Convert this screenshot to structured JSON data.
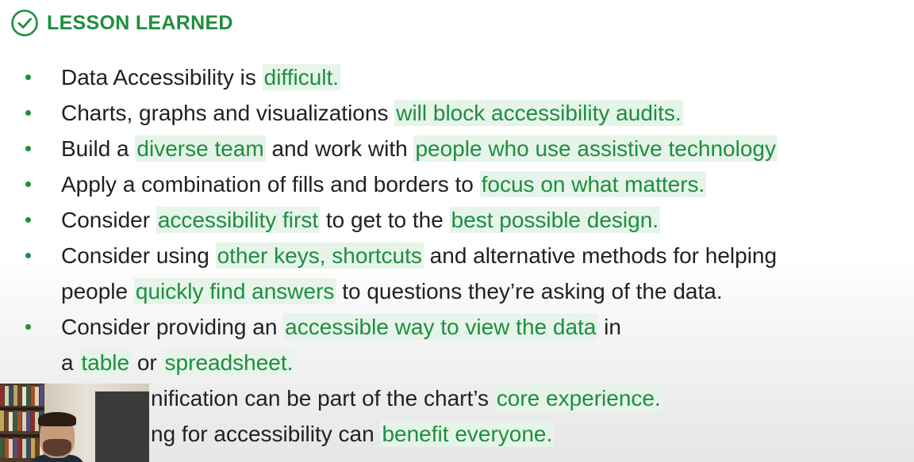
{
  "header": {
    "title": "LESSON LEARNED",
    "icon": "check-circle-icon",
    "color": "#1e8e3e"
  },
  "theme": {
    "accent": "#1e8e3e",
    "highlight_bg": "#e6f4ea",
    "text": "#202124"
  },
  "bullets": [
    {
      "lines": [
        [
          {
            "text": "Data Accessibility is ",
            "hl": false
          },
          {
            "text": "difficult.",
            "hl": true
          }
        ]
      ]
    },
    {
      "lines": [
        [
          {
            "text": "Charts, graphs and visualizations ",
            "hl": false
          },
          {
            "text": "will block accessibility audits.",
            "hl": true
          }
        ]
      ]
    },
    {
      "lines": [
        [
          {
            "text": "Build a ",
            "hl": false
          },
          {
            "text": "diverse team",
            "hl": true
          },
          {
            "text": " and work with ",
            "hl": false
          },
          {
            "text": "people who use assistive technology",
            "hl": true
          }
        ]
      ]
    },
    {
      "lines": [
        [
          {
            "text": "Apply a combination of fills and borders to ",
            "hl": false
          },
          {
            "text": "focus on what matters.",
            "hl": true
          }
        ]
      ]
    },
    {
      "lines": [
        [
          {
            "text": "Consider ",
            "hl": false
          },
          {
            "text": "accessibility first",
            "hl": true
          },
          {
            "text": " to get to the ",
            "hl": false
          },
          {
            "text": "best possible design.",
            "hl": true
          }
        ]
      ]
    },
    {
      "lines": [
        [
          {
            "text": "Consider using ",
            "hl": false
          },
          {
            "text": "other keys, shortcuts",
            "hl": true
          },
          {
            "text": " and alternative methods for helping",
            "hl": false
          }
        ],
        [
          {
            "text": "people ",
            "hl": false
          },
          {
            "text": "quickly find answers",
            "hl": true
          },
          {
            "text": " to questions they’re asking of the data.",
            "hl": false
          }
        ]
      ]
    },
    {
      "lines": [
        [
          {
            "text": "Consider providing an ",
            "hl": false
          },
          {
            "text": "accessible way to view the data",
            "hl": true
          },
          {
            "text": " in",
            "hl": false
          }
        ],
        [
          {
            "text": "a ",
            "hl": false
          },
          {
            "text": "table",
            "hl": true
          },
          {
            "text": " or ",
            "hl": false
          },
          {
            "text": "spreadsheet.",
            "hl": true
          }
        ]
      ]
    },
    {
      "lines": [
        [
          {
            "text": "nification can be part of the chart’s ",
            "hl": false
          },
          {
            "text": "core experience.",
            "hl": true
          }
        ]
      ]
    },
    {
      "lines": [
        [
          {
            "text": "ng for accessibility can ",
            "hl": false
          },
          {
            "text": "benefit everyone.",
            "hl": true
          }
        ]
      ]
    }
  ],
  "webcam": {
    "icon": "presenter-webcam-overlay"
  }
}
